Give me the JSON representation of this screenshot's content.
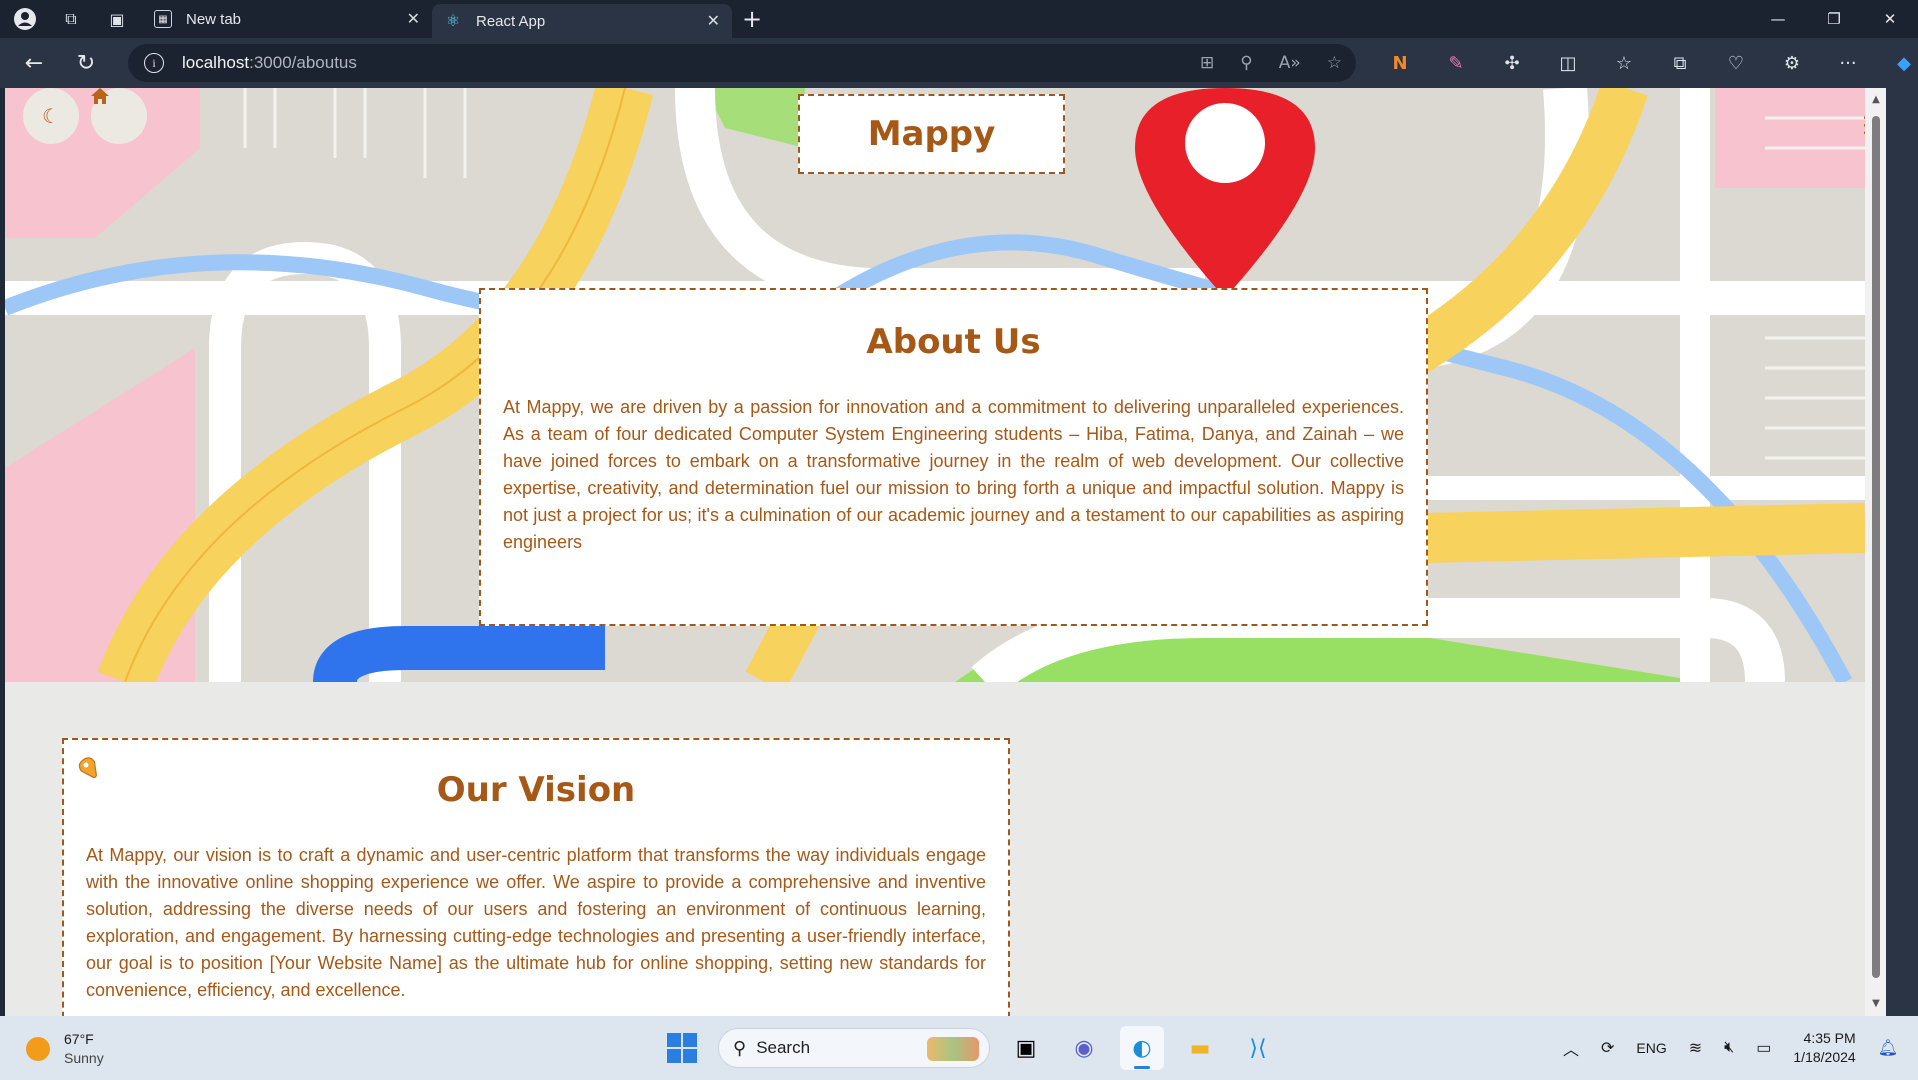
{
  "browser": {
    "tabs": [
      {
        "label": "New tab",
        "active": false
      },
      {
        "label": "React App",
        "active": true
      }
    ],
    "url_host": "localhost",
    "url_path": ":3000/aboutus"
  },
  "page": {
    "logo": "Mappy",
    "about": {
      "title": "About Us",
      "text": "At Mappy, we are driven by a passion for innovation and a commitment to delivering unparalleled experiences. As a team of four dedicated Computer System Engineering students – Hiba, Fatima, Danya, and Zainah – we have joined forces to embark on a transformative journey in the realm of web development. Our collective expertise, creativity, and determination fuel our mission to bring forth a unique and impactful solution. Mappy is not just a project for us; it's a culmination of our academic journey and a testament to our capabilities as aspiring engineers"
    },
    "vision": {
      "title": "Our Vision",
      "text": "At Mappy, our vision is to craft a dynamic and user-centric platform that transforms the way individuals engage with the innovative online shopping experience we offer. We aspire to provide a comprehensive and inventive solution, addressing the diverse needs of our users and fostering an environment of continuous learning, exploration, and engagement. By harnessing cutting-edge technologies and presenting a user-friendly interface, our goal is to position [Your Website Name] as the ultimate hub for online shopping, setting new standards for convenience, efficiency, and excellence."
    },
    "icons": {
      "theme_toggle": "moon-icon",
      "home": "home-icon",
      "menu": "hamburger-icon"
    },
    "colors": {
      "accent": "#a65817",
      "border": "#a0581a",
      "background": "#e9e9e8"
    }
  },
  "taskbar": {
    "weather_temp": "67°F",
    "weather_cond": "Sunny",
    "search_label": "Search",
    "language": "ENG",
    "time": "4:35 PM",
    "date": "1/18/2024"
  }
}
